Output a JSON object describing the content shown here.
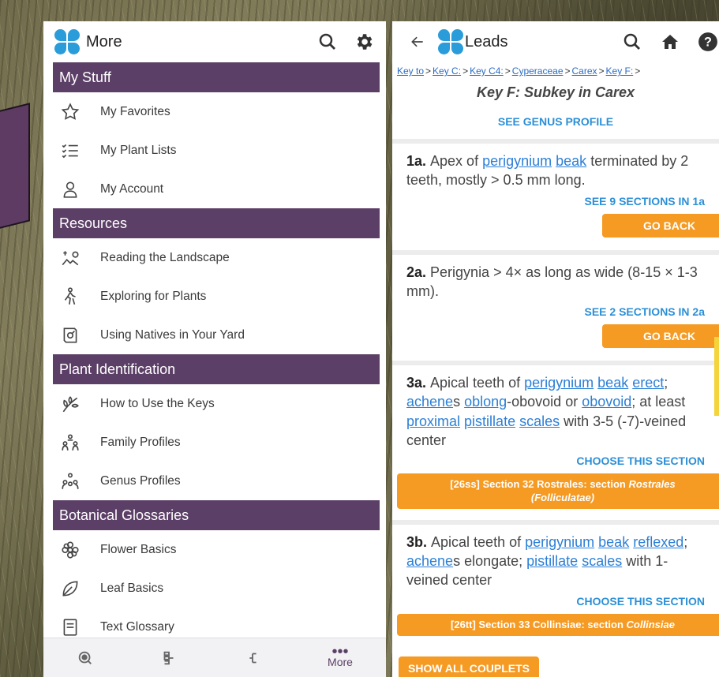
{
  "left": {
    "title": "More",
    "sections": [
      {
        "header": "My Stuff",
        "items": [
          {
            "label": "My Favorites",
            "icon": "star-icon"
          },
          {
            "label": "My Plant Lists",
            "icon": "checklist-icon"
          },
          {
            "label": "My Account",
            "icon": "person-icon"
          }
        ]
      },
      {
        "header": "Resources",
        "items": [
          {
            "label": "Reading the Landscape",
            "icon": "landscape-icon"
          },
          {
            "label": "Exploring for Plants",
            "icon": "hiker-icon"
          },
          {
            "label": "Using Natives in Your Yard",
            "icon": "book-plant-icon"
          }
        ]
      },
      {
        "header": "Plant Identification",
        "items": [
          {
            "label": "How to Use the Keys",
            "icon": "leaf-sprig-icon"
          },
          {
            "label": "Family Profiles",
            "icon": "family-icon"
          },
          {
            "label": "Genus Profiles",
            "icon": "genus-icon"
          }
        ]
      },
      {
        "header": "Botanical Glossaries",
        "items": [
          {
            "label": "Flower Basics",
            "icon": "flower-icon"
          },
          {
            "label": "Leaf Basics",
            "icon": "leaf-icon"
          },
          {
            "label": "Text Glossary",
            "icon": "glossary-icon"
          }
        ]
      }
    ],
    "bottom_nav": [
      {
        "label": "",
        "icon": "search-icon"
      },
      {
        "label": "",
        "icon": "key-tree-icon"
      },
      {
        "label": "",
        "icon": "branch-icon"
      },
      {
        "label": "More",
        "icon": "more-icon"
      }
    ]
  },
  "right": {
    "title": "Leads",
    "breadcrumb": [
      "Key to",
      "Key C:",
      "Key C4:",
      "Cyperaceae",
      "Carex",
      "Key F:"
    ],
    "key_title": "Key F: Subkey in Carex",
    "genus_link": "SEE GENUS PROFILE",
    "couplets": [
      {
        "num": "1a.",
        "text_parts": [
          "Apex of ",
          "perigynium",
          " ",
          "beak",
          " terminated by 2 teeth, mostly > 0.5 mm long."
        ],
        "link": "SEE 9 SECTIONS IN 1a",
        "button": "GO BACK"
      },
      {
        "num": "2a.",
        "text_parts": [
          "Perigynia > 4× as long as wide (8-15 × 1-3 mm)."
        ],
        "link": "SEE 2 SECTIONS IN 2a",
        "button": "GO BACK"
      },
      {
        "num": "3a.",
        "text_parts": [
          "Apical teeth of ",
          "perigynium",
          " ",
          "beak",
          " ",
          "erect",
          "; ",
          "achene",
          "s ",
          "oblong",
          "-obovoid or ",
          "obovoid",
          "; at least ",
          "proximal",
          " ",
          "pistillate",
          " ",
          "scales",
          " with 3-5 (-7)-veined center"
        ],
        "link": "CHOOSE THIS SECTION",
        "button_main": "[26ss] Section 32 Rostrales: section ",
        "button_em": "Rostrales",
        "button_em2": "(Folliculatae)"
      },
      {
        "num": "3b.",
        "text_parts": [
          "Apical teeth of ",
          "perigynium",
          " ",
          "beak",
          " ",
          "reflexed",
          "; ",
          "achene",
          "s elongate; ",
          "pistillate",
          " ",
          "scales",
          " with 1-veined center"
        ],
        "link": "CHOOSE THIS SECTION",
        "button_main": "[26tt] Section 33 Collinsiae: section ",
        "button_em": "Collinsiae"
      }
    ],
    "show_all": "SHOW ALL COUPLETS"
  },
  "colors": {
    "section_header_bg": "#5c3f66",
    "accent_orange": "#f59a22",
    "link_blue": "#2b7fd6"
  }
}
